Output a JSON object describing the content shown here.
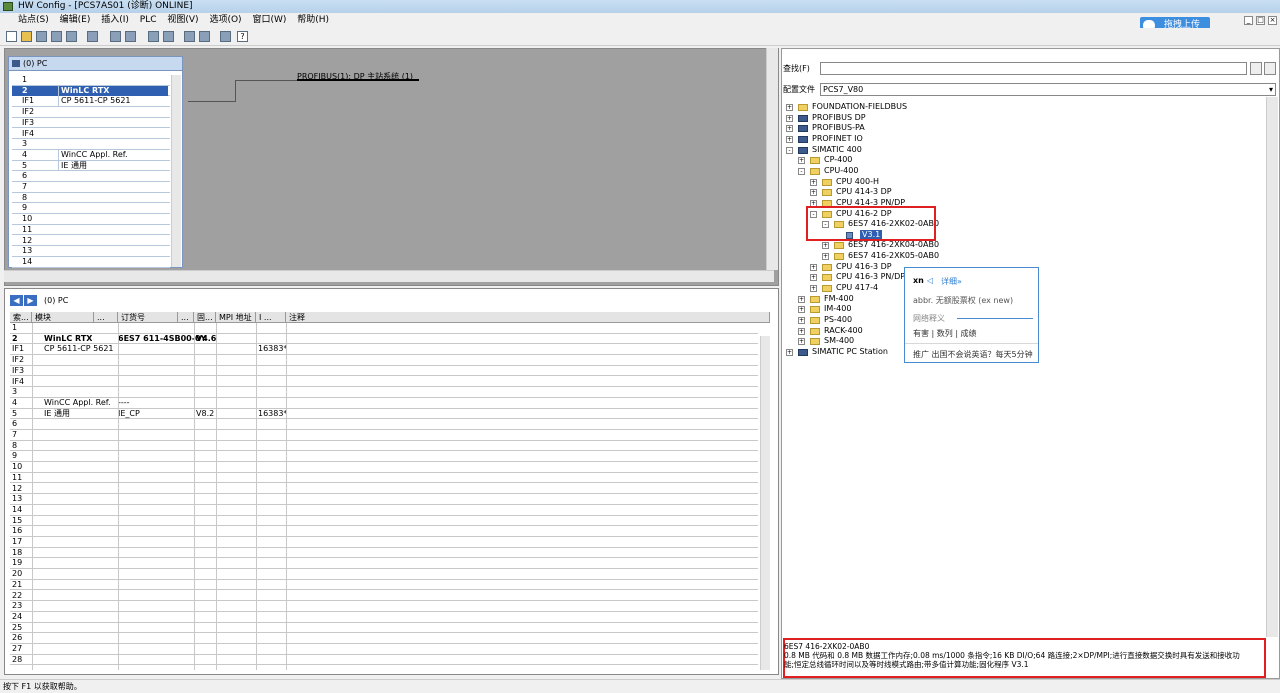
{
  "title": "HW Config - [PCS7AS01 (诊断)  ONLINE]",
  "menu": [
    "站点(S)",
    "编辑(E)",
    "插入(I)",
    "PLC",
    "视图(V)",
    "选项(O)",
    "窗口(W)",
    "帮助(H)"
  ],
  "upload_label": "拖拽上传",
  "rack": {
    "title": "(0)  PC",
    "rows": [
      {
        "slot": "1",
        "module": ""
      },
      {
        "slot": "2",
        "module": "WinLC RTX"
      },
      {
        "slot": "IF1",
        "module": "CP 5611-CP 5621"
      },
      {
        "slot": "IF2",
        "module": ""
      },
      {
        "slot": "IF3",
        "module": ""
      },
      {
        "slot": "IF4",
        "module": ""
      },
      {
        "slot": "3",
        "module": ""
      },
      {
        "slot": "4",
        "module": "WinCC Appl. Ref."
      },
      {
        "slot": "5",
        "module": "IE 通用"
      },
      {
        "slot": "6",
        "module": ""
      },
      {
        "slot": "7",
        "module": ""
      },
      {
        "slot": "8",
        "module": ""
      },
      {
        "slot": "9",
        "module": ""
      },
      {
        "slot": "10",
        "module": ""
      },
      {
        "slot": "11",
        "module": ""
      },
      {
        "slot": "12",
        "module": ""
      },
      {
        "slot": "13",
        "module": ""
      },
      {
        "slot": "14",
        "module": ""
      }
    ]
  },
  "bus_label": "PROFIBUS(1): DP 主站系统 (1)",
  "detail": {
    "title": "(0)   PC",
    "columns": [
      "索...",
      "模块",
      "...",
      "订货号",
      "...",
      "固...",
      "MPI 地址",
      "I ...",
      "注释"
    ],
    "rows": [
      {
        "slot": "1",
        "module": "",
        "order": "",
        "fw": "",
        "mpi": "",
        "io": ""
      },
      {
        "slot": "2",
        "module": "WinLC RTX",
        "order": "6ES7 611-4SB00-0Y",
        "fw": "V4.6",
        "mpi": "",
        "io": ""
      },
      {
        "slot": "IF1",
        "module": "CP 5611-CP 5621",
        "order": "",
        "fw": "",
        "mpi": "",
        "io": "16383*"
      },
      {
        "slot": "IF2",
        "module": "",
        "order": "",
        "fw": "",
        "mpi": "",
        "io": ""
      },
      {
        "slot": "IF3",
        "module": "",
        "order": "",
        "fw": "",
        "mpi": "",
        "io": ""
      },
      {
        "slot": "IF4",
        "module": "",
        "order": "",
        "fw": "",
        "mpi": "",
        "io": ""
      },
      {
        "slot": "3",
        "module": "",
        "order": "",
        "fw": "",
        "mpi": "",
        "io": ""
      },
      {
        "slot": "4",
        "module": "WinCC Appl. Ref.",
        "order": "----",
        "fw": "",
        "mpi": "",
        "io": ""
      },
      {
        "slot": "5",
        "module": "IE 通用",
        "order": "IE_CP",
        "fw": "V8.2",
        "mpi": "",
        "io": "16383*"
      },
      {
        "slot": "6"
      },
      {
        "slot": "7"
      },
      {
        "slot": "8"
      },
      {
        "slot": "9"
      },
      {
        "slot": "10"
      },
      {
        "slot": "11"
      },
      {
        "slot": "12"
      },
      {
        "slot": "13"
      },
      {
        "slot": "14"
      },
      {
        "slot": "15"
      },
      {
        "slot": "16"
      },
      {
        "slot": "17"
      },
      {
        "slot": "18"
      },
      {
        "slot": "19"
      },
      {
        "slot": "20"
      },
      {
        "slot": "21"
      },
      {
        "slot": "22"
      },
      {
        "slot": "23"
      },
      {
        "slot": "24"
      },
      {
        "slot": "25"
      },
      {
        "slot": "26"
      },
      {
        "slot": "27"
      },
      {
        "slot": "28"
      },
      {
        "slot": "29"
      }
    ]
  },
  "catalog": {
    "find_label": "查找(F)",
    "profile_label": "配置文件",
    "profile_value": "PCS7_V80",
    "tree": [
      {
        "level": 0,
        "label": "FOUNDATION-FIELDBUS",
        "exp": "+",
        "icon": "folder"
      },
      {
        "level": 0,
        "label": "PROFIBUS DP",
        "exp": "+",
        "icon": "net"
      },
      {
        "level": 0,
        "label": "PROFIBUS-PA",
        "exp": "+",
        "icon": "net"
      },
      {
        "level": 0,
        "label": "PROFINET IO",
        "exp": "+",
        "icon": "net"
      },
      {
        "level": 0,
        "label": "SIMATIC 400",
        "exp": "-",
        "icon": "net"
      },
      {
        "level": 1,
        "label": "CP-400",
        "exp": "+",
        "icon": "folder"
      },
      {
        "level": 1,
        "label": "CPU-400",
        "exp": "-",
        "icon": "folder"
      },
      {
        "level": 2,
        "label": "CPU 400-H",
        "exp": "+",
        "icon": "folder"
      },
      {
        "level": 2,
        "label": "CPU 414-3 DP",
        "exp": "+",
        "icon": "folder"
      },
      {
        "level": 2,
        "label": "CPU 414-3 PN/DP",
        "exp": "+",
        "icon": "folder"
      },
      {
        "level": 2,
        "label": "CPU 416-2 DP",
        "exp": "-",
        "icon": "folder"
      },
      {
        "level": 3,
        "label": "6ES7 416-2XK02-0AB0",
        "exp": "-",
        "icon": "folder"
      },
      {
        "level": 4,
        "label": "V3.1",
        "exp": "",
        "icon": "module",
        "selected": true
      },
      {
        "level": 3,
        "label": "6ES7 416-2XK04-0AB0",
        "exp": "+",
        "icon": "folder"
      },
      {
        "level": 3,
        "label": "6ES7 416-2XK05-0AB0",
        "exp": "+",
        "icon": "folder"
      },
      {
        "level": 2,
        "label": "CPU 416-3 DP",
        "exp": "+",
        "icon": "folder"
      },
      {
        "level": 2,
        "label": "CPU 416-3 PN/DP",
        "exp": "+",
        "icon": "folder"
      },
      {
        "level": 2,
        "label": "CPU 417-4",
        "exp": "+",
        "icon": "folder"
      },
      {
        "level": 1,
        "label": "FM-400",
        "exp": "+",
        "icon": "folder"
      },
      {
        "level": 1,
        "label": "IM-400",
        "exp": "+",
        "icon": "folder"
      },
      {
        "level": 1,
        "label": "PS-400",
        "exp": "+",
        "icon": "folder"
      },
      {
        "level": 1,
        "label": "RACK-400",
        "exp": "+",
        "icon": "folder"
      },
      {
        "level": 1,
        "label": "SM-400",
        "exp": "+",
        "icon": "folder"
      },
      {
        "level": 0,
        "label": "SIMATIC PC Station",
        "exp": "+",
        "icon": "net"
      }
    ],
    "info_order": "6ES7 416-2XK02-0AB0",
    "info_line1": "0.8 MB 代码和 0.8 MB 数据工作内存;0.08 ms/1000 条指令;16 KB DI/O;64 路连接;2×DP/MPI;进行直接数据交换时具有发送和接收功",
    "info_line2": "能;恒定总线循环时间以及等时线模式路由;带多值计算功能;固化程序 V3.1"
  },
  "popup": {
    "brand": "xn",
    "detail_link": "详细»",
    "line1": "abbr. 无额股票权 (ex new)",
    "line2": "网络释义",
    "line3": "有害 | 数列 | 成绩",
    "line4": "推广  出国不会说英语？每天5分钟"
  },
  "status": "按下 F1 以获取帮助。"
}
